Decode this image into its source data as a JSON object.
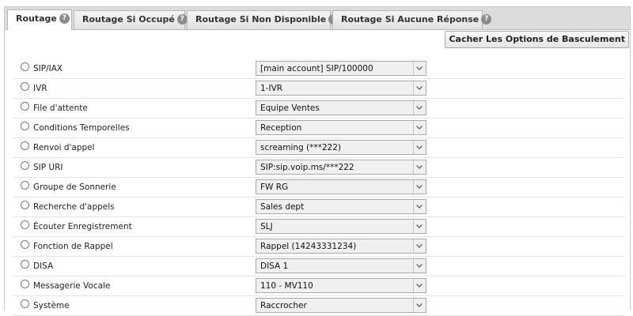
{
  "tabs": [
    {
      "label": "Routage",
      "active": true
    },
    {
      "label": "Routage Si Occupé",
      "active": false
    },
    {
      "label": "Routage Si Non Disponible",
      "active": false
    },
    {
      "label": "Routage Si Aucune Réponse",
      "active": false
    }
  ],
  "toggle_button": "Cacher Les Options de Basculement",
  "rows": [
    {
      "label": "SIP/IAX",
      "value": "[main account] SIP/100000"
    },
    {
      "label": "IVR",
      "value": "1-IVR"
    },
    {
      "label": "File d'attente",
      "value": "Equipe Ventes"
    },
    {
      "label": "Conditions Temporelles",
      "value": "Reception"
    },
    {
      "label": "Renvoi d'appel",
      "value": "screaming (***222)"
    },
    {
      "label": "SIP URI",
      "value": "SIP:sip.voip.ms/***222"
    },
    {
      "label": "Groupe de Sonnerie",
      "value": "FW RG"
    },
    {
      "label": "Recherche d'appels",
      "value": "Sales dept"
    },
    {
      "label": "Écouter Enregistrement",
      "value": "SLJ"
    },
    {
      "label": "Fonction de Rappel",
      "value": "Rappel (14243331234)"
    },
    {
      "label": "DISA",
      "value": "DISA 1"
    },
    {
      "label": "Messagerie Vocale",
      "value": "110 - MV110"
    },
    {
      "label": "Système",
      "value": "Raccrocher"
    }
  ],
  "icons": {
    "tab_help": "help-icon",
    "dropdown": "chevron-down-icon"
  },
  "colors": {
    "tab_bar": "#dcdcdc",
    "active_tab": "#ffffff",
    "select_bg": "#f0f0f0"
  }
}
